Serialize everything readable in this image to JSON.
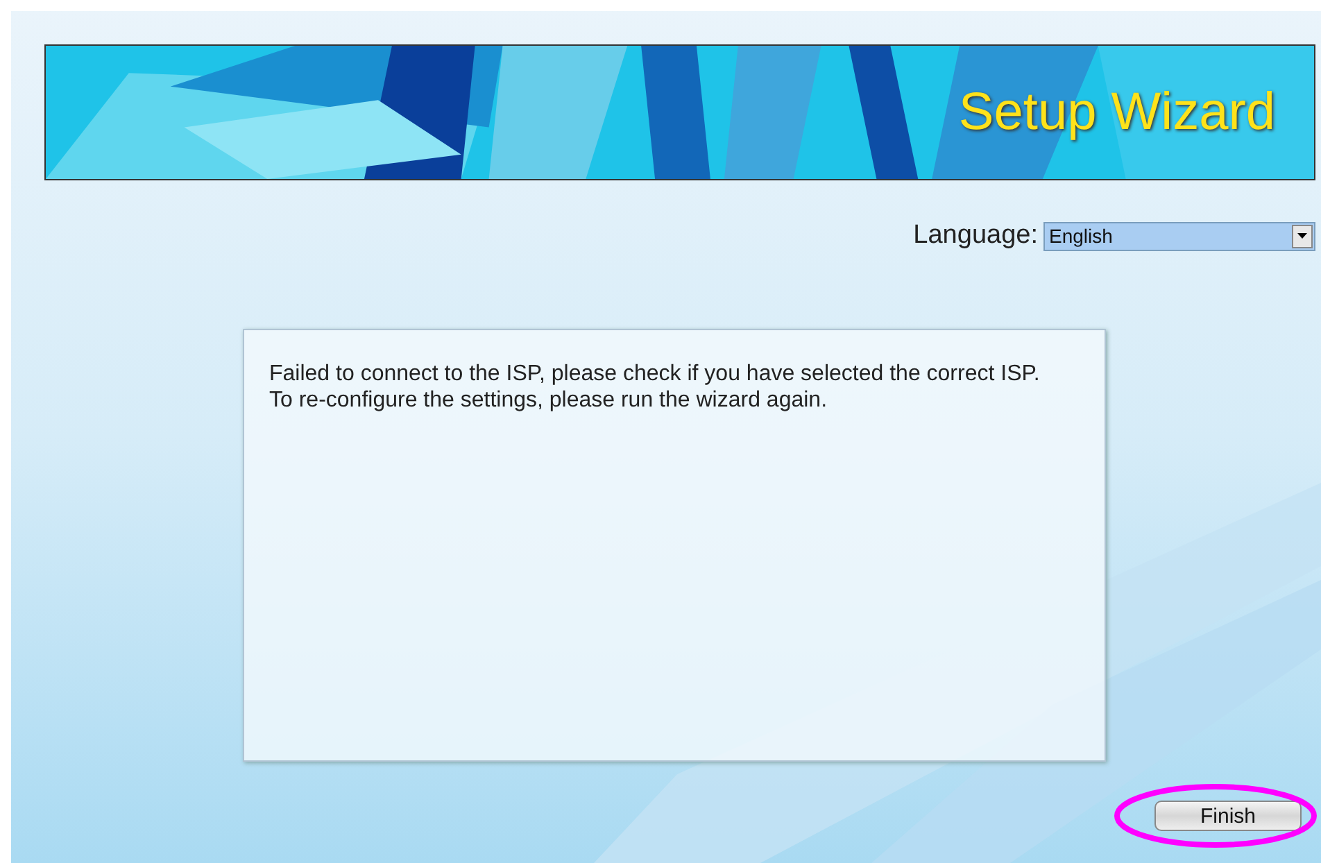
{
  "banner": {
    "title": "Setup Wizard"
  },
  "language": {
    "label": "Language:",
    "value": "English"
  },
  "message": "Failed to connect to the ISP, please check if you have selected the correct ISP. To re-configure the settings, please run the wizard again.",
  "buttons": [
    {
      "label": "Finish",
      "highlighted": true
    }
  ]
}
